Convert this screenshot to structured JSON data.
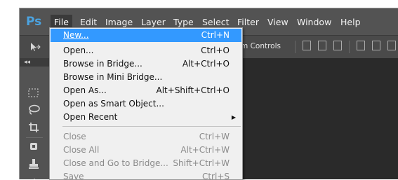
{
  "app": {
    "logo": "Ps"
  },
  "menubar": {
    "items": [
      "File",
      "Edit",
      "Image",
      "Layer",
      "Type",
      "Select",
      "Filter",
      "View",
      "Window",
      "Help"
    ],
    "active_index": 0
  },
  "options_bar": {
    "text": "m Controls"
  },
  "panel": {
    "collapse_glyph": "◂◂"
  },
  "file_menu": {
    "items": [
      {
        "label": "New...",
        "shortcut": "Ctrl+N",
        "highlighted": true
      },
      {
        "label": "Open...",
        "shortcut": "Ctrl+O"
      },
      {
        "label": "Browse in Bridge...",
        "shortcut": "Alt+Ctrl+O"
      },
      {
        "label": "Browse in Mini Bridge...",
        "shortcut": ""
      },
      {
        "label": "Open As...",
        "shortcut": "Alt+Shift+Ctrl+O"
      },
      {
        "label": "Open as Smart Object...",
        "shortcut": ""
      },
      {
        "label": "Open Recent",
        "shortcut": "",
        "submenu": true
      },
      {
        "label": "Close",
        "shortcut": "Ctrl+W",
        "disabled": true
      },
      {
        "label": "Close All",
        "shortcut": "Alt+Ctrl+W",
        "disabled": true
      },
      {
        "label": "Close and Go to Bridge...",
        "shortcut": "Shift+Ctrl+W",
        "disabled": true
      },
      {
        "label": "Save",
        "shortcut": "Ctrl+S",
        "disabled": true
      }
    ]
  },
  "colors": {
    "menubar_bg": "#535353",
    "highlight": "#3399ff",
    "logo": "#4ba3e0"
  }
}
